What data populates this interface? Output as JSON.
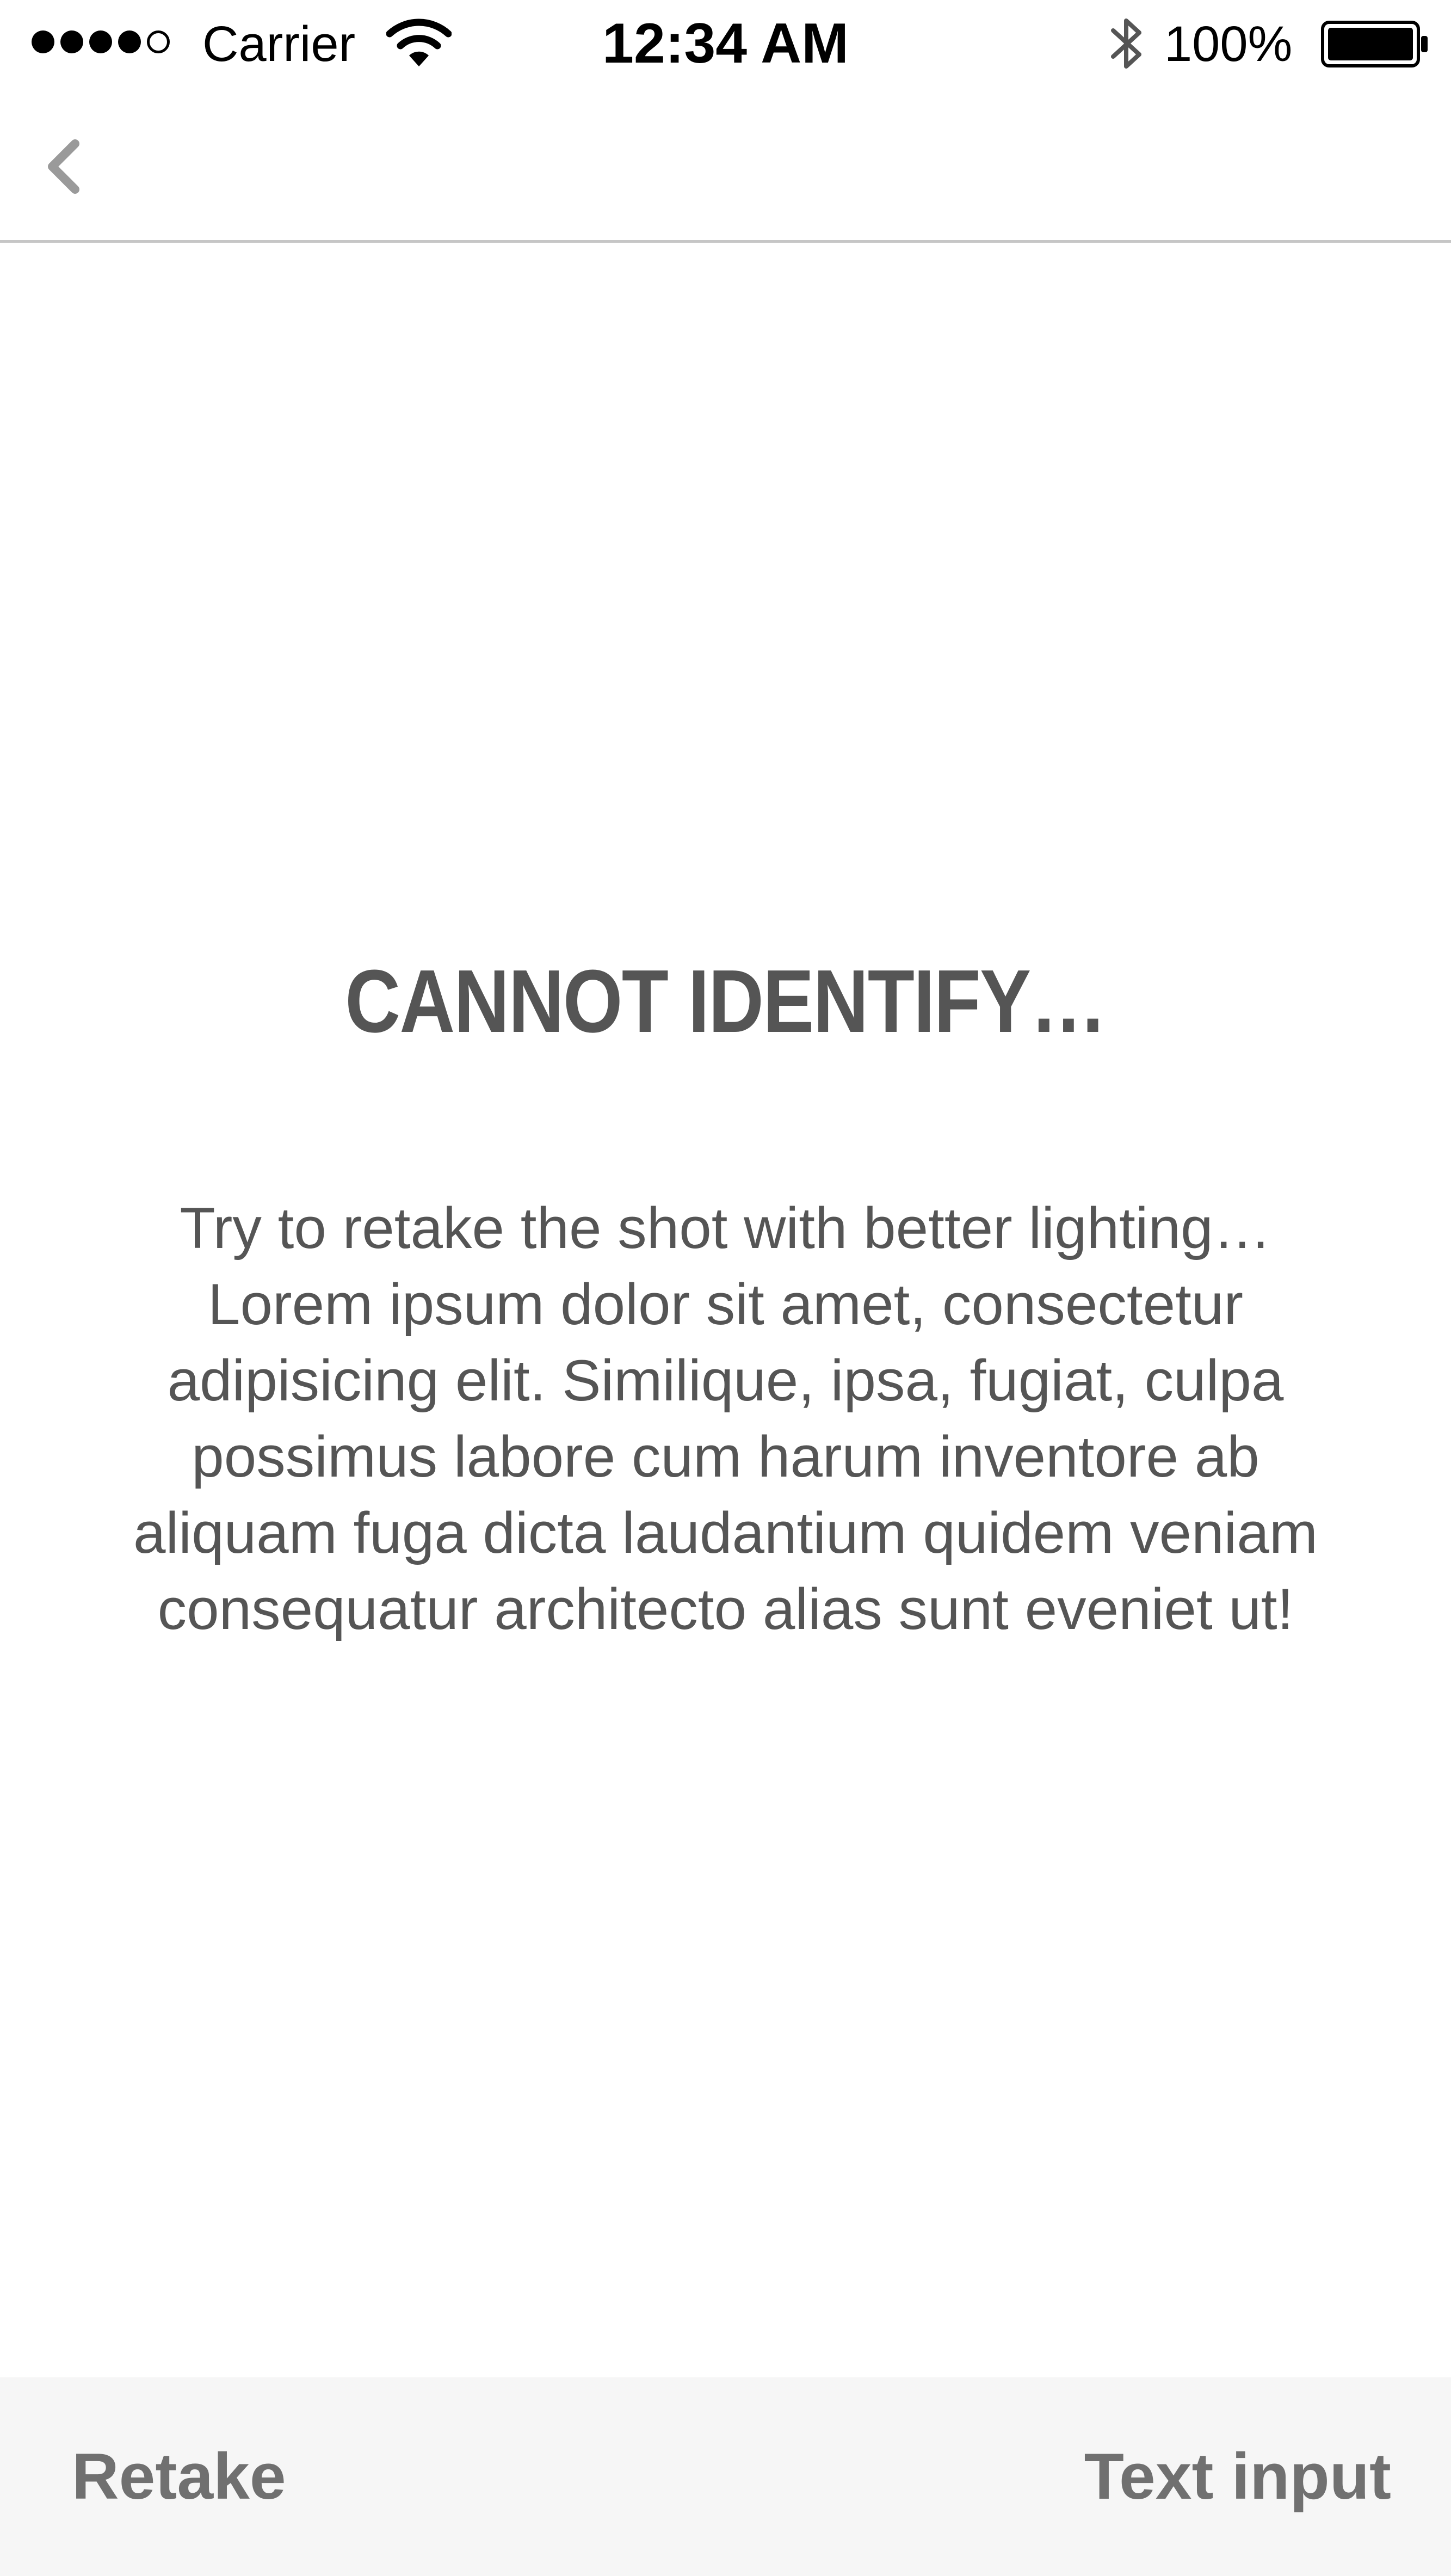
{
  "status_bar": {
    "carrier": "Carrier",
    "time": "12:34 AM",
    "battery_percent": "100%",
    "signal_bars_filled": 4,
    "signal_bars_total": 5,
    "icons": [
      "signal-dots-icon",
      "wifi-icon",
      "bluetooth-icon",
      "battery-icon"
    ]
  },
  "nav": {
    "back_icon": "chevron-left-icon"
  },
  "content": {
    "title": "CANNOT IDENTIFY…",
    "message": "Try to retake the shot with better lighting…Lorem ipsum dolor sit amet, consectetur adipisicing elit. Similique, ipsa, fugiat, culpa possimus labore cum harum inventore ab aliquam fuga dicta laudantium quidem veniam consequatur architecto alias sunt eveniet ut!"
  },
  "toolbar": {
    "retake_label": "Retake",
    "text_input_label": "Text input"
  },
  "colors": {
    "text": "#555555",
    "button_text": "#707070",
    "toolbar_bg": "#f6f6f6",
    "divider": "#c6c6c6",
    "back_icon": "#9a9a9a"
  }
}
